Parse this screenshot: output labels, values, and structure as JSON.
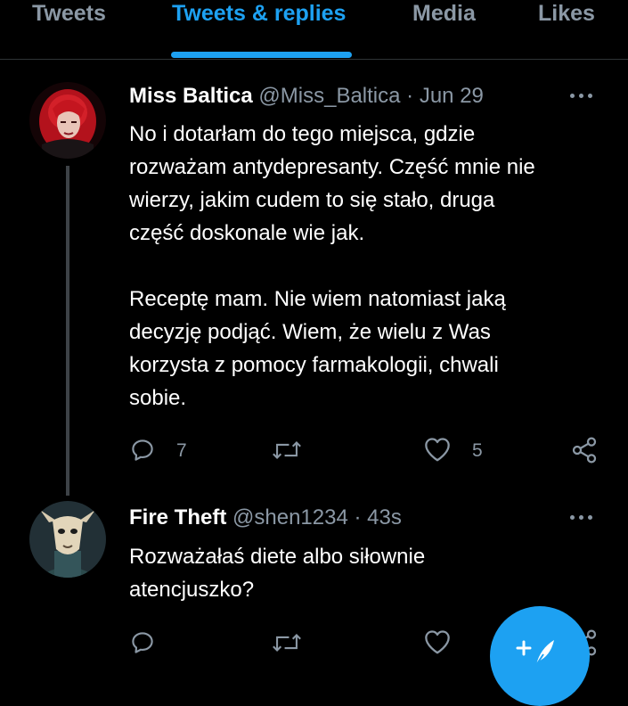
{
  "tabs": [
    {
      "label": "Tweets"
    },
    {
      "label": "Tweets & replies"
    },
    {
      "label": "Media"
    },
    {
      "label": "Likes"
    }
  ],
  "active_tab": "Tweets & replies",
  "accent_color": "#1da1f2",
  "tweets": [
    {
      "name": "Miss Baltica",
      "handle": "@Miss_Baltica",
      "separator": "·",
      "time": "Jun 29",
      "body_lines": [
        "No i dotarłam do tego miejsca, gdzie",
        "rozważam antydepresanty. Część mnie nie",
        "wierzy, jakim cudem to się stało, druga",
        "część doskonale wie jak.",
        "",
        "Receptę mam. Nie wiem natomiast jaką",
        "decyzję podjąć. Wiem, że wielu z Was",
        "korzysta z pomocy farmakologii, chwali",
        "sobie."
      ],
      "reply_count": "7",
      "like_count": "5"
    },
    {
      "name": "Fire Theft",
      "handle": "@shen1234",
      "separator": "·",
      "time": "43s",
      "body_lines": [
        "Rozważałaś diete albo siłownie",
        "atencjuszko?"
      ]
    }
  ]
}
